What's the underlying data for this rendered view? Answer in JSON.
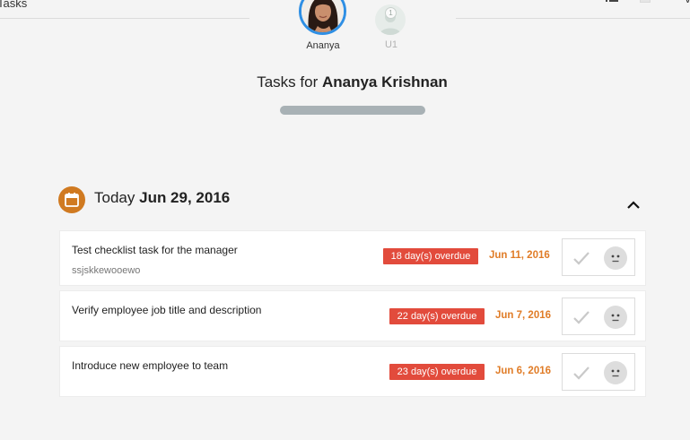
{
  "header": {
    "page_label": "Tasks",
    "cut_text": "Vi"
  },
  "assignees": [
    {
      "label": "Ananya",
      "selected": true
    },
    {
      "label": "U1",
      "badge": "1",
      "selected": false
    }
  ],
  "page_title": {
    "prefix": "Tasks for ",
    "name": "Ananya Krishnan"
  },
  "section": {
    "label": "Today",
    "date": "Jun 29, 2016",
    "icon": "calendar-icon",
    "accent_color": "#d07a21"
  },
  "tasks": [
    {
      "title": "Test checklist task for the manager",
      "subtitle": "ssjskkewooewo",
      "overdue": "18 day(s) overdue",
      "due": "Jun 11, 2016"
    },
    {
      "title": "Verify employee job title and description",
      "overdue": "22 day(s) overdue",
      "due": "Jun 7, 2016"
    },
    {
      "title": "Introduce new employee to team",
      "overdue": "23 day(s) overdue",
      "due": "Jun 6, 2016"
    }
  ],
  "colors": {
    "overdue": "#e24b3c",
    "due_date": "#e07c27",
    "avatar_ring": "#2f8fe4"
  }
}
